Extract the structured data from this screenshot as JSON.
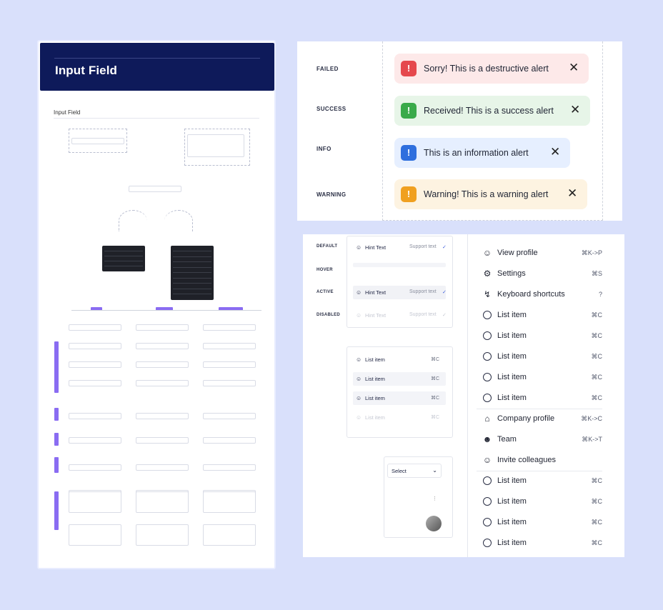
{
  "doc": {
    "title": "Input Field",
    "subtitle": "Input Field"
  },
  "alerts": {
    "items": [
      {
        "label": "FAILED",
        "text": "Sorry! This is a destructive alert",
        "bg": "#fde9e9",
        "icon_color": "#e5484d",
        "icon": "alert-circle-icon"
      },
      {
        "label": "SUCCESS",
        "text": "Received! This is a success alert",
        "bg": "#e7f5e8",
        "icon_color": "#3aaa4a",
        "icon": "alert-circle-icon"
      },
      {
        "label": "INFO",
        "text": "This is an information alert",
        "bg": "#e6efff",
        "icon_color": "#2f6fde",
        "icon": "alert-circle-icon"
      },
      {
        "label": "WARNING",
        "text": "Warning! This is a warning alert",
        "bg": "#fdf3e1",
        "icon_color": "#f0a020",
        "icon": "alert-circle-icon"
      }
    ],
    "close_glyph": "✕"
  },
  "states": {
    "labels": [
      "DEFAULT",
      "HOVER",
      "ACTIVE",
      "DISABLED"
    ],
    "hint_text": "Hint Text",
    "support_text": "Support text",
    "list_item": "List item",
    "shortcut": "⌘C",
    "select_label": "Select"
  },
  "menu": {
    "items": [
      {
        "label": "View profile",
        "kbd": "⌘K->P",
        "icon": "user-icon"
      },
      {
        "label": "Settings",
        "kbd": "⌘S",
        "icon": "gear-icon"
      },
      {
        "label": "Keyboard shortcuts",
        "kbd": "?",
        "icon": "lightning-icon"
      },
      {
        "label": "List item",
        "kbd": "⌘C",
        "icon": "circle-icon"
      },
      {
        "label": "List item",
        "kbd": "⌘C",
        "icon": "circle-icon"
      },
      {
        "label": "List item",
        "kbd": "⌘C",
        "icon": "circle-icon"
      },
      {
        "label": "List item",
        "kbd": "⌘C",
        "icon": "circle-icon"
      },
      {
        "label": "List item",
        "kbd": "⌘C",
        "icon": "circle-icon"
      },
      {
        "label": "Company profile",
        "kbd": "⌘K->C",
        "icon": "building-icon"
      },
      {
        "label": "Team",
        "kbd": "⌘K->T",
        "icon": "team-icon"
      },
      {
        "label": "Invite colleagues",
        "kbd": "",
        "icon": "user-plus-icon"
      },
      {
        "label": "List item",
        "kbd": "⌘C",
        "icon": "circle-icon"
      },
      {
        "label": "List item",
        "kbd": "⌘C",
        "icon": "circle-icon"
      },
      {
        "label": "List item",
        "kbd": "⌘C",
        "icon": "circle-icon"
      },
      {
        "label": "List item",
        "kbd": "⌘C",
        "icon": "circle-icon"
      }
    ]
  }
}
